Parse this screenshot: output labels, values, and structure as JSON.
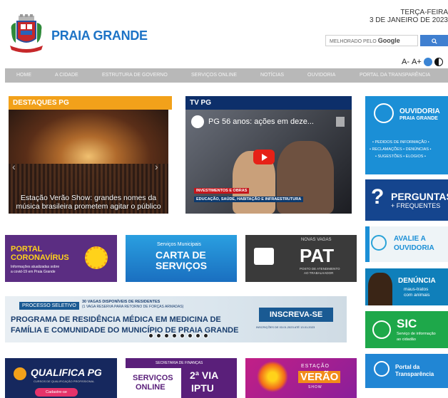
{
  "header": {
    "brand": "PRAIA GRANDE",
    "date_line1": "TERÇA-FEIRA",
    "date_line2": "3 DE JANEIRO DE 2023",
    "search_label": "MELHORADO PELO",
    "search_brand": "Google",
    "search_icon": "search-icon",
    "font_small": "A-",
    "font_large": "A+"
  },
  "nav": {
    "items": [
      "HOME",
      "A CIDADE",
      "ESTRUTURA DE GOVERNO",
      "SERVIÇOS ONLINE",
      "NOTÍCIAS",
      "OUVIDORIA",
      "PORTAL DA TRANSPARÊNCIA"
    ]
  },
  "destaques": {
    "title": "DESTAQUES PG",
    "caption": "Estação Verão Show: grandes nomes da música brasileira prometem agitar o público"
  },
  "tvpg": {
    "title": "TV PG",
    "video_title": "PG 56 anos: ações em deze...",
    "tag1": "INVESTIMENTOS E OBRAS",
    "tag2": "EDUCAÇÃO, SAÚDE, HABITAÇÃO E INFRAESTRUTURA"
  },
  "sidebar": {
    "ouvidoria_title": "OUVIDORIA",
    "ouvidoria_sub": "PRAIA GRANDE",
    "ouvidoria_items": "• PEDIDOS DE INFORMAÇÃO •",
    "ouvidoria_items2": "• RECLAMAÇÕES • DENÚNCIAS •",
    "ouvidoria_items3": "• SUGESTÕES • ELOGIOS •",
    "perguntas": "PERGUNTAS",
    "frequentes": "+ FREQUENTES",
    "avalie1": "AVALIE A",
    "avalie2": "OUVIDORIA",
    "denuncia": "DENÚNCIA",
    "denuncia_sub1": "maus-tratos",
    "denuncia_sub2": "com animais",
    "sic": "SIC",
    "sic_sub1": "Serviço de informação",
    "sic_sub2": "ao cidadão",
    "portal1": "Portal da",
    "portal2": "Transparência"
  },
  "banners": {
    "corona1": "PORTAL",
    "corona2": "CORONAVÍRUS",
    "corona_sub1": "Informações atualizadas sobre",
    "corona_sub2": "a covid-19 em Praia Grande",
    "carta_top": "Serviços Municipais",
    "carta1": "CARTA DE",
    "carta2": "SERVIÇOS",
    "pat_top": "NOVAS VAGAS",
    "pat": "PAT",
    "pat_sub1": "POSTO DE ATENDIMENTO",
    "pat_sub2": "AO TRABALHADOR"
  },
  "residencia": {
    "label": "PROCESSO SELETIVO",
    "vagas1": "30 VAGAS DISPONÍVEIS DE RESIDENTES",
    "vagas2": "(1 VAGA RESERVA PARA RETORNO DE FORÇAS ARMADAS)",
    "line1": "PROGRAMA DE RESIDÊNCIA MÉDICA EM MEDICINA DE",
    "line2": "FAMÍLIA E COMUNIDADE DO MUNICÍPIO DE PRAIA GRANDE",
    "cta": "INSCREVA-SE",
    "cta_sub": "INSCRIÇÕES DE 03.01.2023 ATÉ 13.01.2023"
  },
  "bottom": {
    "qualifica": "QUALIFICA PG",
    "qualifica_sub": "CURSOS DE QUALIFICAÇÃO PROFISSIONAL",
    "cadastre": "Cadastre-se",
    "financas": "SECRETARIA DE FINANÇAS",
    "servicos1": "SERVIÇOS",
    "servicos2": "ONLINE",
    "iptu1": "2ª VIA",
    "iptu2": "IPTU",
    "estacao": "ESTAÇÃO",
    "verao": "VERÃO",
    "show": "SHOW"
  }
}
